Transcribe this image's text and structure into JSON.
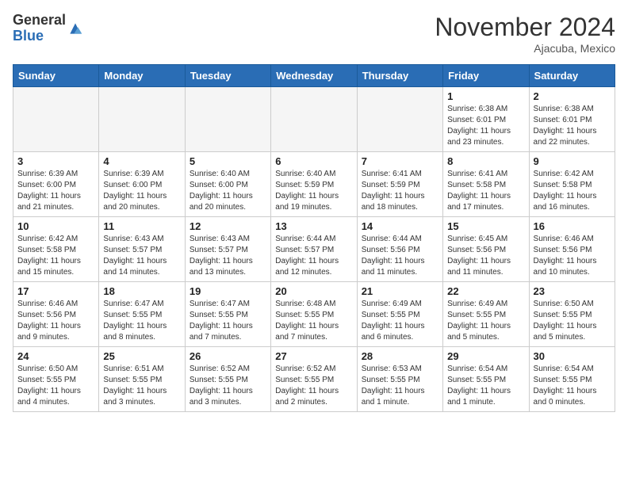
{
  "header": {
    "logo_general": "General",
    "logo_blue": "Blue",
    "month_title": "November 2024",
    "subtitle": "Ajacuba, Mexico"
  },
  "days_of_week": [
    "Sunday",
    "Monday",
    "Tuesday",
    "Wednesday",
    "Thursday",
    "Friday",
    "Saturday"
  ],
  "weeks": [
    [
      {
        "day": "",
        "info": ""
      },
      {
        "day": "",
        "info": ""
      },
      {
        "day": "",
        "info": ""
      },
      {
        "day": "",
        "info": ""
      },
      {
        "day": "",
        "info": ""
      },
      {
        "day": "1",
        "info": "Sunrise: 6:38 AM\nSunset: 6:01 PM\nDaylight: 11 hours and 23 minutes."
      },
      {
        "day": "2",
        "info": "Sunrise: 6:38 AM\nSunset: 6:01 PM\nDaylight: 11 hours and 22 minutes."
      }
    ],
    [
      {
        "day": "3",
        "info": "Sunrise: 6:39 AM\nSunset: 6:00 PM\nDaylight: 11 hours and 21 minutes."
      },
      {
        "day": "4",
        "info": "Sunrise: 6:39 AM\nSunset: 6:00 PM\nDaylight: 11 hours and 20 minutes."
      },
      {
        "day": "5",
        "info": "Sunrise: 6:40 AM\nSunset: 6:00 PM\nDaylight: 11 hours and 20 minutes."
      },
      {
        "day": "6",
        "info": "Sunrise: 6:40 AM\nSunset: 5:59 PM\nDaylight: 11 hours and 19 minutes."
      },
      {
        "day": "7",
        "info": "Sunrise: 6:41 AM\nSunset: 5:59 PM\nDaylight: 11 hours and 18 minutes."
      },
      {
        "day": "8",
        "info": "Sunrise: 6:41 AM\nSunset: 5:58 PM\nDaylight: 11 hours and 17 minutes."
      },
      {
        "day": "9",
        "info": "Sunrise: 6:42 AM\nSunset: 5:58 PM\nDaylight: 11 hours and 16 minutes."
      }
    ],
    [
      {
        "day": "10",
        "info": "Sunrise: 6:42 AM\nSunset: 5:58 PM\nDaylight: 11 hours and 15 minutes."
      },
      {
        "day": "11",
        "info": "Sunrise: 6:43 AM\nSunset: 5:57 PM\nDaylight: 11 hours and 14 minutes."
      },
      {
        "day": "12",
        "info": "Sunrise: 6:43 AM\nSunset: 5:57 PM\nDaylight: 11 hours and 13 minutes."
      },
      {
        "day": "13",
        "info": "Sunrise: 6:44 AM\nSunset: 5:57 PM\nDaylight: 11 hours and 12 minutes."
      },
      {
        "day": "14",
        "info": "Sunrise: 6:44 AM\nSunset: 5:56 PM\nDaylight: 11 hours and 11 minutes."
      },
      {
        "day": "15",
        "info": "Sunrise: 6:45 AM\nSunset: 5:56 PM\nDaylight: 11 hours and 11 minutes."
      },
      {
        "day": "16",
        "info": "Sunrise: 6:46 AM\nSunset: 5:56 PM\nDaylight: 11 hours and 10 minutes."
      }
    ],
    [
      {
        "day": "17",
        "info": "Sunrise: 6:46 AM\nSunset: 5:56 PM\nDaylight: 11 hours and 9 minutes."
      },
      {
        "day": "18",
        "info": "Sunrise: 6:47 AM\nSunset: 5:55 PM\nDaylight: 11 hours and 8 minutes."
      },
      {
        "day": "19",
        "info": "Sunrise: 6:47 AM\nSunset: 5:55 PM\nDaylight: 11 hours and 7 minutes."
      },
      {
        "day": "20",
        "info": "Sunrise: 6:48 AM\nSunset: 5:55 PM\nDaylight: 11 hours and 7 minutes."
      },
      {
        "day": "21",
        "info": "Sunrise: 6:49 AM\nSunset: 5:55 PM\nDaylight: 11 hours and 6 minutes."
      },
      {
        "day": "22",
        "info": "Sunrise: 6:49 AM\nSunset: 5:55 PM\nDaylight: 11 hours and 5 minutes."
      },
      {
        "day": "23",
        "info": "Sunrise: 6:50 AM\nSunset: 5:55 PM\nDaylight: 11 hours and 5 minutes."
      }
    ],
    [
      {
        "day": "24",
        "info": "Sunrise: 6:50 AM\nSunset: 5:55 PM\nDaylight: 11 hours and 4 minutes."
      },
      {
        "day": "25",
        "info": "Sunrise: 6:51 AM\nSunset: 5:55 PM\nDaylight: 11 hours and 3 minutes."
      },
      {
        "day": "26",
        "info": "Sunrise: 6:52 AM\nSunset: 5:55 PM\nDaylight: 11 hours and 3 minutes."
      },
      {
        "day": "27",
        "info": "Sunrise: 6:52 AM\nSunset: 5:55 PM\nDaylight: 11 hours and 2 minutes."
      },
      {
        "day": "28",
        "info": "Sunrise: 6:53 AM\nSunset: 5:55 PM\nDaylight: 11 hours and 1 minute."
      },
      {
        "day": "29",
        "info": "Sunrise: 6:54 AM\nSunset: 5:55 PM\nDaylight: 11 hours and 1 minute."
      },
      {
        "day": "30",
        "info": "Sunrise: 6:54 AM\nSunset: 5:55 PM\nDaylight: 11 hours and 0 minutes."
      }
    ]
  ]
}
